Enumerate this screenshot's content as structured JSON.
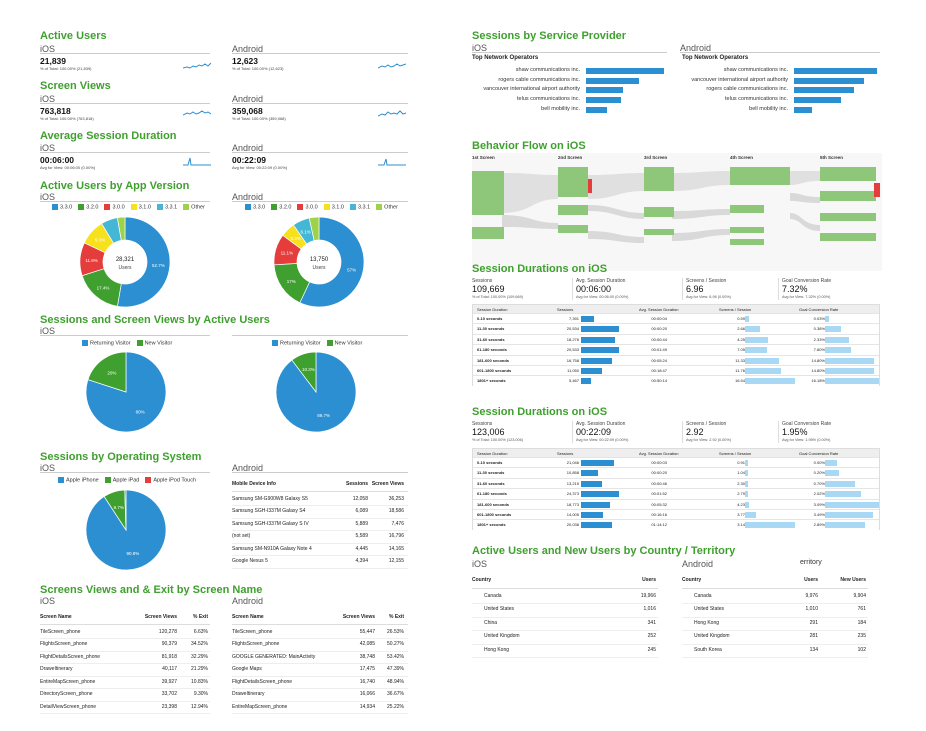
{
  "colors": {
    "green": "#3fa02f",
    "blue": "#2b8fd1",
    "lightblue": "#a9d8f4",
    "flowgreen": "#8ec77a",
    "red": "#e53c3c",
    "orange": "#f08a24",
    "yellow": "#f7e01c",
    "teal": "#44b6d6",
    "lime": "#9ed24a",
    "gray": "#d4d4d4"
  },
  "active_users": {
    "title": "Active Users",
    "ios": {
      "label": "iOS",
      "value": "21,839",
      "note": "% of Total: 100.00% (21,839)"
    },
    "android": {
      "label": "Android",
      "value": "12,623",
      "note": "% of Total: 100.00% (12,623)"
    }
  },
  "screen_views": {
    "title": "Screen Views",
    "ios": {
      "label": "iOS",
      "value": "763,818",
      "note": "% of Total: 100.00% (763,818)"
    },
    "android": {
      "label": "Android",
      "value": "359,068",
      "note": "% of Total: 100.00% (359,068)"
    }
  },
  "avg_session": {
    "title": "Average Session Duration",
    "ios": {
      "label": "iOS",
      "value": "00:06:00",
      "note": "Avg for View: 00:06:00 (0.00%)"
    },
    "android": {
      "label": "Android",
      "value": "00:22:09",
      "note": "Avg for View: 00:22:09 (0.00%)"
    }
  },
  "app_version": {
    "title": "Active Users by App Version",
    "ios_label": "iOS",
    "android_label": "Android",
    "legend": [
      "3.3.0",
      "3.2.0",
      "3.0.0",
      "3.1.0",
      "3.3.1",
      "Other"
    ],
    "ios": {
      "center_value": "28,321",
      "center_label": "Users",
      "slices": [
        {
          "v": 52.7,
          "c": "#2b8fd1",
          "l": "52.7%"
        },
        {
          "v": 17.4,
          "c": "#3fa02f",
          "l": "17.4%"
        },
        {
          "v": 11.9,
          "c": "#e53c3c",
          "l": "11.9%"
        },
        {
          "v": 9.3,
          "c": "#f7e01c",
          "l": "9.3%"
        },
        {
          "v": 6.0,
          "c": "#44b6d6",
          "l": ""
        },
        {
          "v": 2.7,
          "c": "#9ed24a",
          "l": ""
        }
      ]
    },
    "android": {
      "center_value": "13,750",
      "center_label": "Users",
      "slices": [
        {
          "v": 57,
          "c": "#2b8fd1",
          "l": "57%"
        },
        {
          "v": 17,
          "c": "#3fa02f",
          "l": "17%"
        },
        {
          "v": 11.1,
          "c": "#e53c3c",
          "l": "11.1%"
        },
        {
          "v": 5.3,
          "c": "#f7e01c",
          "l": "5.3%"
        },
        {
          "v": 6.1,
          "c": "#44b6d6",
          "l": "6.1%"
        },
        {
          "v": 3.5,
          "c": "#9ed24a",
          "l": ""
        }
      ]
    }
  },
  "visitors": {
    "title": "Sessions and Screen Views by Active Users",
    "ios_label": "iOS",
    "legend": [
      "Returning Visitor",
      "New Visitor"
    ],
    "ios": [
      {
        "v": 80,
        "c": "#2b8fd1",
        "l": "80%"
      },
      {
        "v": 20,
        "c": "#3fa02f",
        "l": "20%"
      }
    ],
    "android": [
      {
        "v": 89.7,
        "c": "#2b8fd1",
        "l": "89.7%"
      },
      {
        "v": 10.3,
        "c": "#3fa02f",
        "l": "10.3%"
      }
    ]
  },
  "os": {
    "title": "Sessions by Operating System",
    "ios_label": "iOS",
    "android_label": "Android",
    "legend": [
      "Apple iPhone",
      "Apple iPad",
      "Apple iPod Touch"
    ],
    "ios": [
      {
        "v": 90.8,
        "c": "#2b8fd1",
        "l": "90.8%"
      },
      {
        "v": 8.7,
        "c": "#3fa02f",
        "l": "8.7%"
      },
      {
        "v": 0.5,
        "c": "#e53c3c",
        "l": ""
      }
    ],
    "device_headers": [
      "Mobile Device Info",
      "Sessions",
      "Screen Views"
    ],
    "devices": [
      [
        "Samsung SM-G900W8 Galaxy S5",
        "12,058",
        "36,253"
      ],
      [
        "Samsung SGH-I337M Galaxy S4",
        "6,089",
        "18,586"
      ],
      [
        "Samsung SGH-I337M Galaxy S IV",
        "5,889",
        "7,476"
      ],
      [
        "(not set)",
        "5,589",
        "16,796"
      ],
      [
        "Samsung SM-N910A Galaxy Note 4",
        "4,445",
        "14,165"
      ],
      [
        "Google Nexus 5",
        "4,394",
        "12,155"
      ]
    ]
  },
  "screens": {
    "title": "Screens Views and & Exit by Screen Name",
    "ios_label": "iOS",
    "android_label": "Android",
    "headers": [
      "Screen Name",
      "Screen Views",
      "% Exit"
    ],
    "ios": [
      [
        "TileScreen_phone",
        "120,278",
        "6.63%"
      ],
      [
        "FlightsScreen_phone",
        "90,379",
        "34.52%"
      ],
      [
        "FlightDetailsScreen_phone",
        "81,918",
        "32.29%"
      ],
      [
        "DraweItinerary",
        "40,117",
        "21.29%"
      ],
      [
        "EntireMapScreen_phone",
        "39,927",
        "10.83%"
      ],
      [
        "DirectoryScreen_phone",
        "33,702",
        "9.30%"
      ],
      [
        "DetailViewScreen_phone",
        "23,398",
        "12.94%"
      ]
    ],
    "android": [
      [
        "TileScreen_phone",
        "55,447",
        "26.53%"
      ],
      [
        "FlightsScreen_phone",
        "42,085",
        "50.27%"
      ],
      [
        "GOOGLE GENERATED: MainActivity",
        "38,748",
        "53.42%"
      ],
      [
        "Google Maps",
        "17,475",
        "47.39%"
      ],
      [
        "FlightDetailsScreen_phone",
        "16,740",
        "48.94%"
      ],
      [
        "DraweItinerary",
        "16,066",
        "36.67%"
      ],
      [
        "EntireMapScreen_phone",
        "14,934",
        "25.22%"
      ]
    ]
  },
  "providers": {
    "title": "Sessions by Service Provider",
    "ios_label": "iOS",
    "android_label": "Android",
    "subheader": "Top Network Operators",
    "ios": [
      {
        "n": "shaw communications inc.",
        "v": 100
      },
      {
        "n": "rogers cable communications inc.",
        "v": 68
      },
      {
        "n": "vancouver international airport authority",
        "v": 48
      },
      {
        "n": "telus communications inc.",
        "v": 45
      },
      {
        "n": "bell mobility inc.",
        "v": 27
      }
    ],
    "android": [
      {
        "n": "shaw communications inc.",
        "v": 100
      },
      {
        "n": "vancouver international airport authority",
        "v": 84
      },
      {
        "n": "rogers cable communications inc.",
        "v": 72
      },
      {
        "n": "telus communications inc.",
        "v": 57
      },
      {
        "n": "bell mobility inc.",
        "v": 22
      }
    ]
  },
  "flow": {
    "title": "Behavior Flow on iOS",
    "columns": [
      "1st Screen",
      "2nd Screen",
      "3rd Screen",
      "4th Screen",
      "5th Screen"
    ]
  },
  "dur_ios": {
    "title": "Session Durations on iOS",
    "kpis": [
      {
        "label": "Sessions",
        "value": "109,669",
        "note": "% of Total: 100.00% (109,669)"
      },
      {
        "label": "Avg. Session Duration",
        "value": "00:06:00",
        "note": "Avg for View: 00:06:00 (0.00%)"
      },
      {
        "label": "Screens / Session",
        "value": "6.96",
        "note": "Avg for View: 6.96 (0.00%)"
      },
      {
        "label": "Goal Conversion Rate",
        "value": "7.32%",
        "note": "Avg for View: 7.32% (0.00%)"
      }
    ],
    "headers": [
      "Session Duration",
      "Sessions",
      "Avg. Session Duration",
      "Screens / Session",
      "Goal Conversion Rate"
    ],
    "rows": [
      [
        "0-10 seconds",
        "7,391",
        "00:00:04",
        "0.59",
        "0.03%"
      ],
      [
        "11-30 seconds",
        "20,534",
        "00:00:20",
        "2.66",
        "0.38%"
      ],
      [
        "31-60 seconds",
        "18,276",
        "00:00:44",
        "4.25",
        "2.33%"
      ],
      [
        "61-180 seconds",
        "20,533",
        "00:01:49",
        "7.05",
        "7.80%"
      ],
      [
        "181-600 seconds",
        "16,758",
        "00:05:24",
        "11.33",
        "14.80%"
      ],
      [
        "601-1800 seconds",
        "11,050",
        "00:18:47",
        "11.76",
        "14.80%"
      ],
      [
        "1801+ seconds",
        "5,467",
        "00:50:14",
        "16.54",
        "16.18%"
      ]
    ],
    "bars": [
      [
        0.35,
        0.08,
        0.08
      ],
      [
        1,
        0.3,
        0.3
      ],
      [
        0.89,
        0.45,
        0.45
      ],
      [
        1,
        0.43,
        0.48
      ],
      [
        0.82,
        0.68,
        0.91
      ],
      [
        0.54,
        0.71,
        0.91
      ],
      [
        0.27,
        1,
        1
      ]
    ]
  },
  "dur_and": {
    "title": "Session Durations on iOS",
    "kpis": [
      {
        "label": "Sessions",
        "value": "123,006",
        "note": "% of Total: 100.00% (123,006)"
      },
      {
        "label": "Avg. Session Duration",
        "value": "00:22:09",
        "note": "Avg for View: 00:22:09 (0.00%)"
      },
      {
        "label": "Screens / Session",
        "value": "2.92",
        "note": "Avg for View: 2.92 (0.00%)"
      },
      {
        "label": "Goal Conversion Rate",
        "value": "1.95%",
        "note": "Avg for View: 1.95% (0.00%)"
      }
    ],
    "headers": [
      "Session Duration",
      "Sessions",
      "Avg. Session Duration",
      "Screens / Session",
      "Goal Conversion Rate"
    ],
    "rows": [
      [
        "0-10 seconds",
        "21,046",
        "00:00:03",
        "0.91",
        "0.00%"
      ],
      [
        "11-30 seconds",
        "10,858",
        "00:00:20",
        "1.04",
        "0.20%"
      ],
      [
        "31-60 seconds",
        "13,215",
        "00:00:46",
        "2.30",
        "0.70%"
      ],
      [
        "61-180 seconds",
        "24,373",
        "00:01:52",
        "2.79",
        "2.02%"
      ],
      [
        "181-600 seconds",
        "18,773",
        "00:05:32",
        "4.23",
        "3.09%"
      ],
      [
        "601-1800 seconds",
        "14,005",
        "00:16:16",
        "3.77",
        "3.49%"
      ],
      [
        "1801+ seconds",
        "20,038",
        "01:14:12",
        "3.14",
        "2.89%"
      ]
    ],
    "bars": [
      [
        0.86,
        0.05,
        0.22
      ],
      [
        0.45,
        0.05,
        0.25
      ],
      [
        0.54,
        0.05,
        0.55
      ],
      [
        1,
        0.05,
        0.66
      ],
      [
        0.77,
        0.08,
        1
      ],
      [
        0.57,
        0.22,
        0.89
      ],
      [
        0.82,
        1,
        0.74
      ]
    ]
  },
  "country": {
    "title": "Active Users and New Users by Country / Territory",
    "ios_label": "iOS",
    "android_label": "Android",
    "android_title_fragment": "erritory",
    "ios_headers": [
      "Country",
      "Users"
    ],
    "android_headers": [
      "Country",
      "Users",
      "New Users"
    ],
    "ios": [
      [
        "Canada",
        "19,966"
      ],
      [
        "United States",
        "1,016"
      ],
      [
        "China",
        "341"
      ],
      [
        "United Kingdom",
        "252"
      ],
      [
        "Hong Kong",
        "245"
      ]
    ],
    "android": [
      [
        "Canada",
        "9,976",
        "9,904"
      ],
      [
        "United States",
        "1,010",
        "761"
      ],
      [
        "Hong Kong",
        "291",
        "184"
      ],
      [
        "United Kingdom",
        "281",
        "235"
      ],
      [
        "South Korea",
        "134",
        "102"
      ]
    ]
  }
}
